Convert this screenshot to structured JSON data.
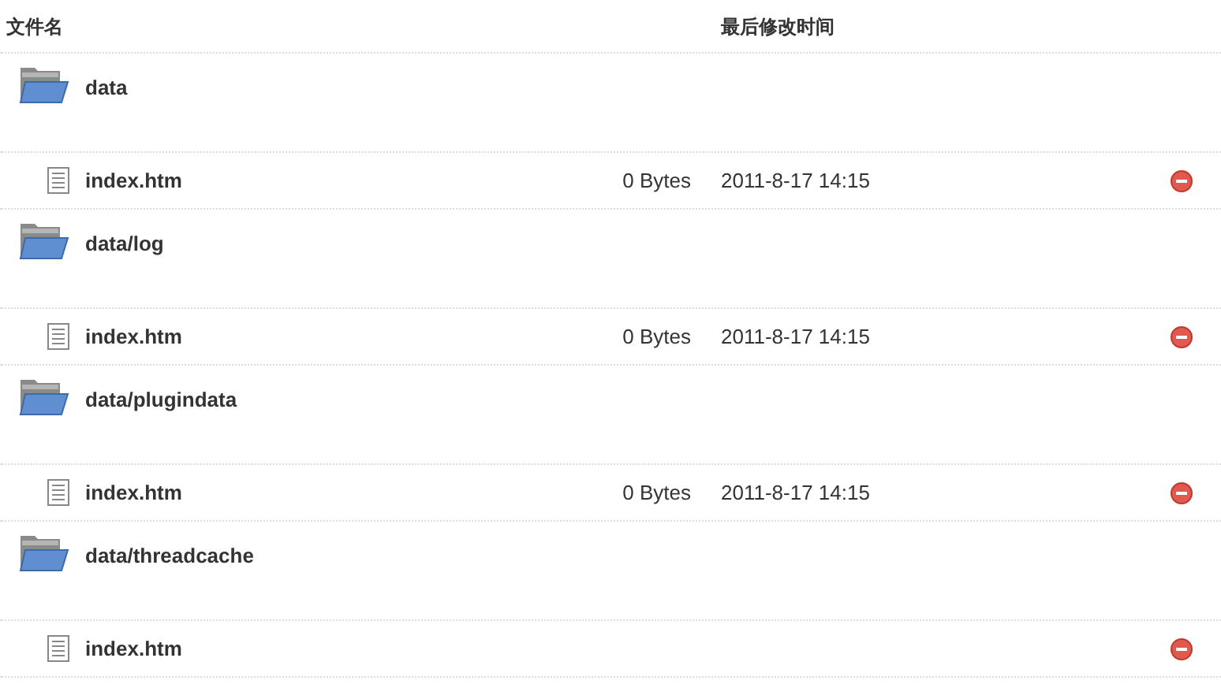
{
  "columns": {
    "name": "文件名",
    "modified": "最后修改时间"
  },
  "groups": [
    {
      "folder": "data",
      "files": [
        {
          "name": "index.htm",
          "size": "0 Bytes",
          "modified": "2011-8-17 14:15"
        }
      ]
    },
    {
      "folder": "data/log",
      "files": [
        {
          "name": "index.htm",
          "size": "0 Bytes",
          "modified": "2011-8-17 14:15"
        }
      ]
    },
    {
      "folder": "data/plugindata",
      "files": [
        {
          "name": "index.htm",
          "size": "0 Bytes",
          "modified": "2011-8-17 14:15"
        }
      ]
    },
    {
      "folder": "data/threadcache",
      "files": [
        {
          "name": "index.htm"
        }
      ]
    }
  ]
}
